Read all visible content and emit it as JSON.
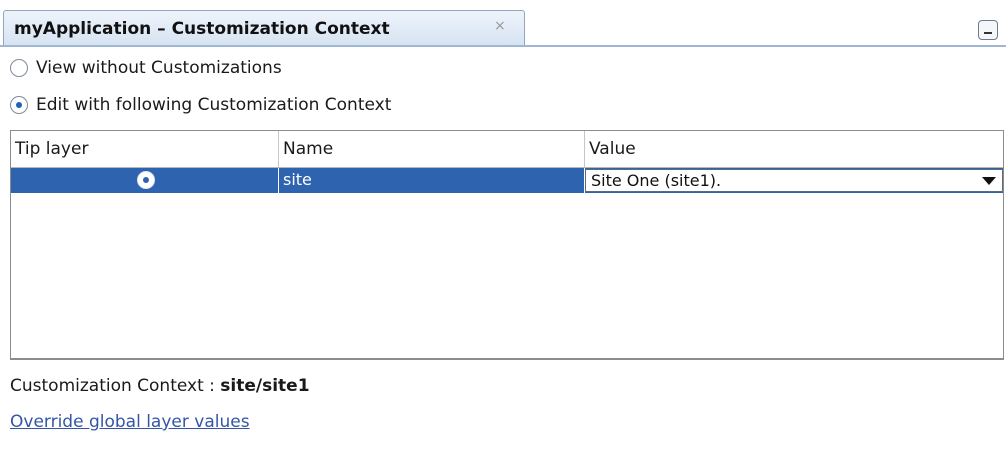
{
  "tab": {
    "title": "myApplication – Customization Context",
    "close_glyph": "×"
  },
  "icons": {
    "close": "close-icon",
    "minimize": "minimize-icon",
    "dropdown": "chevron-down-icon"
  },
  "options": {
    "view_without": {
      "label": "View without Customizations",
      "selected": false
    },
    "edit_with": {
      "label": "Edit with following Customization Context",
      "selected": true
    }
  },
  "table": {
    "columns": [
      "Tip layer",
      "Name",
      "Value"
    ],
    "rows": [
      {
        "tip_layer_selected": true,
        "name": "site",
        "value": "Site One (site1)."
      }
    ]
  },
  "context": {
    "label": "Customization Context : ",
    "value": "site/site1"
  },
  "override_link": "Override global layer values",
  "colors": {
    "selection": "#2e63b0",
    "link": "#3456a8",
    "tab_border": "#9fb7d4"
  }
}
